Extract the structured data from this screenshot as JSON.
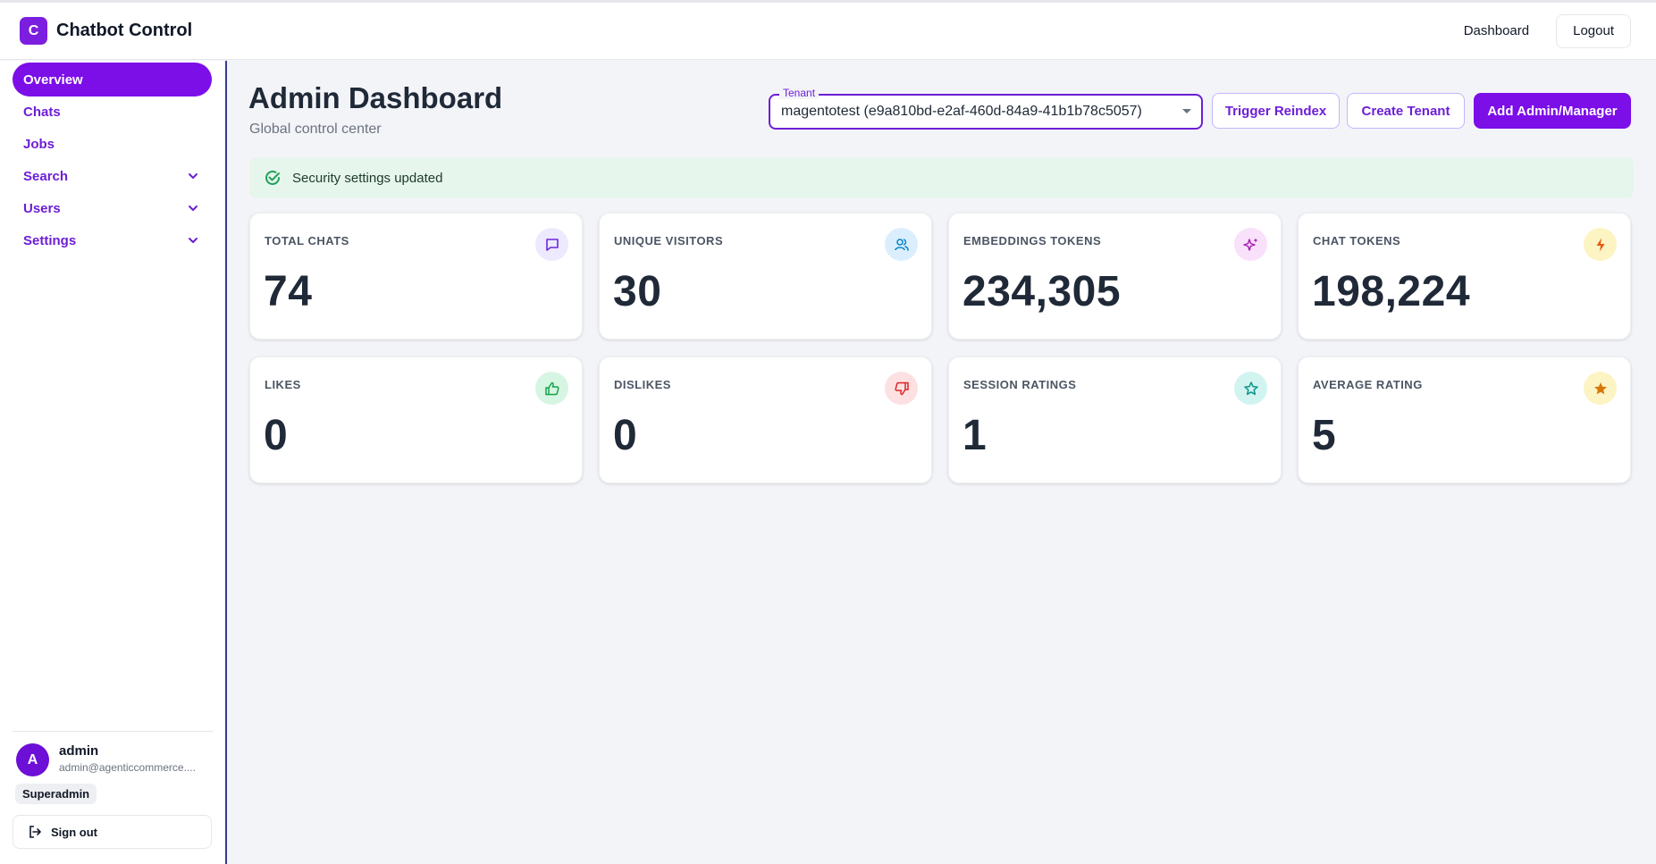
{
  "app": {
    "logo_letter": "C",
    "title": "Chatbot Control"
  },
  "topbar": {
    "dashboard_link": "Dashboard",
    "logout_label": "Logout"
  },
  "sidebar": {
    "items": [
      {
        "label": "Overview",
        "active": true
      },
      {
        "label": "Chats"
      },
      {
        "label": "Jobs"
      },
      {
        "label": "Search",
        "expandable": true
      },
      {
        "label": "Users",
        "expandable": true
      },
      {
        "label": "Settings",
        "expandable": true
      }
    ],
    "user": {
      "avatar_letter": "A",
      "name": "admin",
      "email": "admin@agenticcommerce....",
      "role": "Superadmin"
    },
    "signout_label": "Sign out"
  },
  "page": {
    "title": "Admin Dashboard",
    "subtitle": "Global control center"
  },
  "tenant": {
    "label": "Tenant",
    "value": "magentotest (e9a810bd-e2af-460d-84a9-41b1b78c5057)"
  },
  "actions": {
    "reindex_label": "Trigger Reindex",
    "create_tenant_label": "Create Tenant",
    "add_admin_label": "Add Admin/Manager"
  },
  "alert": {
    "text": "Security settings updated",
    "icon": "check-circle-icon",
    "color": "#22a05a"
  },
  "stats": [
    {
      "label": "TOTAL CHATS",
      "value": "74",
      "icon": "chat-icon",
      "icon_bg": "#ede9fe",
      "icon_color": "#6d28d9"
    },
    {
      "label": "UNIQUE VISITORS",
      "value": "30",
      "icon": "users-icon",
      "icon_bg": "#dbeefe",
      "icon_color": "#0284c7"
    },
    {
      "label": "EMBEDDINGS TOKENS",
      "value": "234,305",
      "icon": "sparkles-icon",
      "icon_bg": "#fae1fb",
      "icon_color": "#a21caf"
    },
    {
      "label": "CHAT TOKENS",
      "value": "198,224",
      "icon": "bolt-icon",
      "icon_bg": "#fdf4c4",
      "icon_color": "#ea580c"
    },
    {
      "label": "LIKES",
      "value": "0",
      "icon": "thumbs-up-icon",
      "icon_bg": "#d7f5e3",
      "icon_color": "#16a34a"
    },
    {
      "label": "DISLIKES",
      "value": "0",
      "icon": "thumbs-down-icon",
      "icon_bg": "#fde0e2",
      "icon_color": "#dc2626"
    },
    {
      "label": "SESSION RATINGS",
      "value": "1",
      "icon": "star-outline-icon",
      "icon_bg": "#d2f4f1",
      "icon_color": "#0d9488"
    },
    {
      "label": "AVERAGE RATING",
      "value": "5",
      "icon": "star-icon",
      "icon_bg": "#fdf4c4",
      "icon_color": "#d97706"
    }
  ],
  "colors": {
    "accent": "#7c0ee8",
    "sidebar_text": "#6d1ed6",
    "background": "#f3f4f8"
  }
}
